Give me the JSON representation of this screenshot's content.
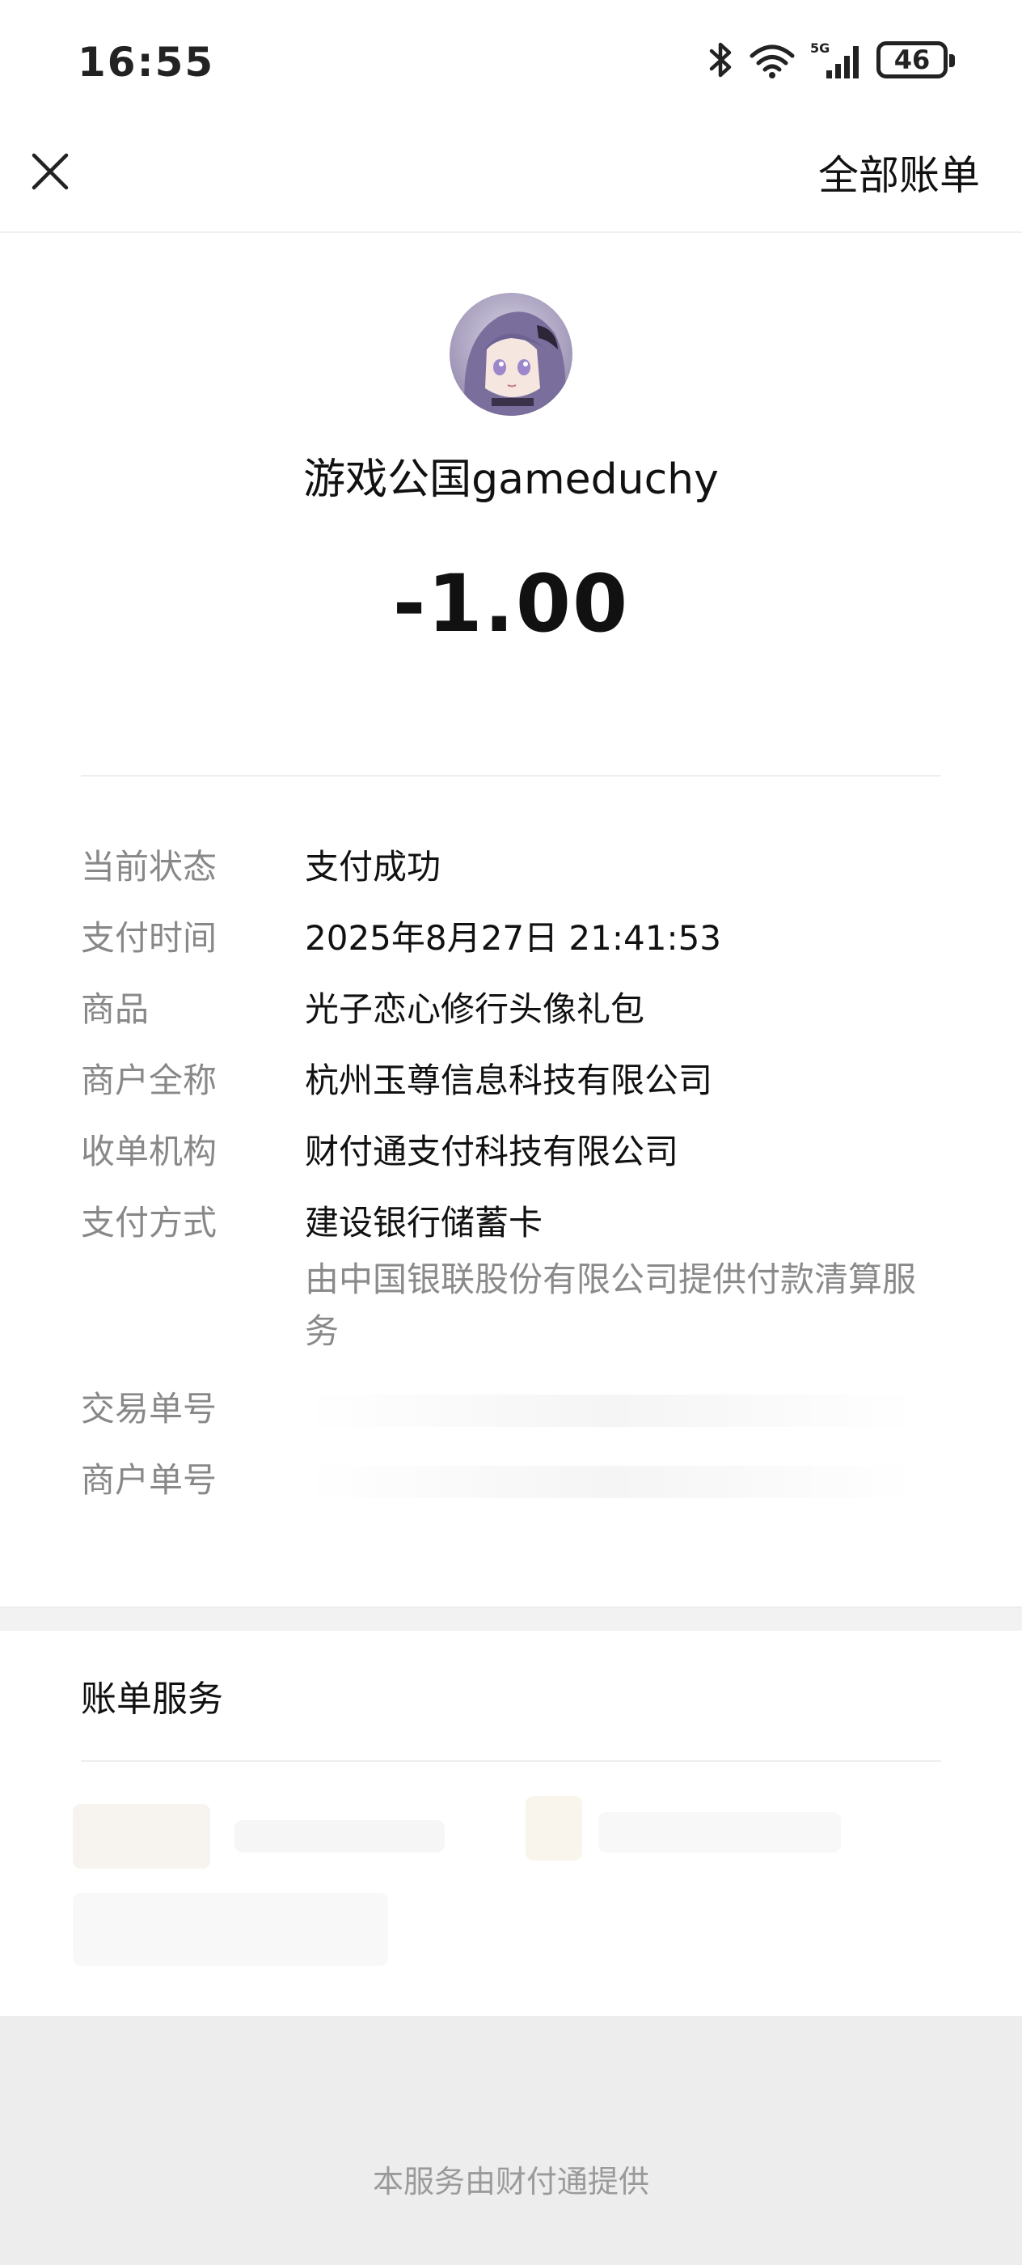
{
  "status_bar": {
    "time": "16:55",
    "battery": "46",
    "network": "5G"
  },
  "header": {
    "all_bills_label": "全部账单"
  },
  "merchant": {
    "name": "游戏公国gameduchy",
    "amount": "-1.00"
  },
  "details": {
    "status_label": "当前状态",
    "status_value": "支付成功",
    "time_label": "支付时间",
    "time_value": "2025年8月27日 21:41:53",
    "product_label": "商品",
    "product_value": "光子恋心修行头像礼包",
    "merchant_full_label": "商户全称",
    "merchant_full_value": "杭州玉尊信息科技有限公司",
    "acquirer_label": "收单机构",
    "acquirer_value": "财付通支付科技有限公司",
    "payment_method_label": "支付方式",
    "payment_method_value": "建设银行储蓄卡",
    "payment_method_note": "由中国银联股份有限公司提供付款清算服务",
    "transaction_no_label": "交易单号",
    "merchant_no_label": "商户单号"
  },
  "services": {
    "title": "账单服务"
  },
  "footer": {
    "text": "本服务由财付通提供"
  },
  "colors": {
    "label_gray": "#888888",
    "footer_bg": "#ededed"
  }
}
